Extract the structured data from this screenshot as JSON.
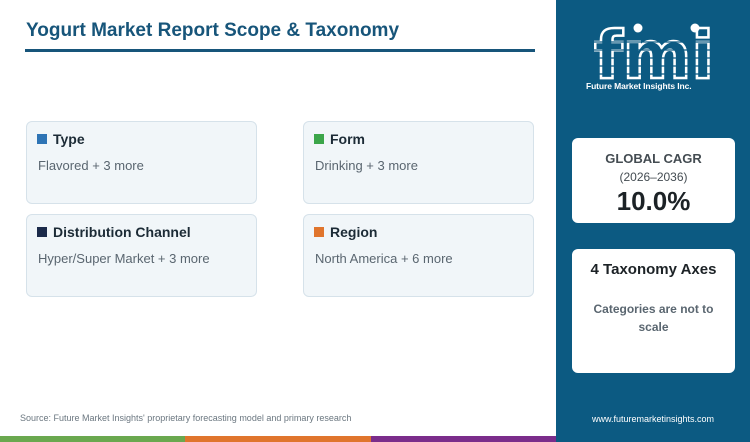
{
  "title": "Yogurt Market Report Scope & Taxonomy",
  "cards": [
    {
      "label": "Type",
      "summary": "Flavored + 3 more",
      "color": "#2e74b5"
    },
    {
      "label": "Form",
      "summary": "Drinking + 3 more",
      "color": "#3ca64a"
    },
    {
      "label": "Distribution Channel",
      "summary": "Hyper/Super Market + 3 more",
      "color": "#1b2a4a"
    },
    {
      "label": "Region",
      "summary": "North America + 6 more",
      "color": "#e0752d"
    }
  ],
  "source": "Source: Future Market Insights' proprietary forecasting model and primary research",
  "sidebar": {
    "logo_text": "fmi",
    "logo_subtitle": "Future Market Insights Inc.",
    "cagr": {
      "label": "GLOBAL CAGR",
      "period": "(2026–2036)",
      "value": "10.0%"
    },
    "axes": {
      "title": "4 Taxonomy Axes",
      "note": "Categories are not to scale"
    },
    "website": "www.futuremarketinsights.com"
  },
  "colors": {
    "title": "#17557a",
    "sidebar": "#0c5a82",
    "card_bg": "#f1f6f9"
  },
  "icons": [
    "fmi-logo"
  ]
}
